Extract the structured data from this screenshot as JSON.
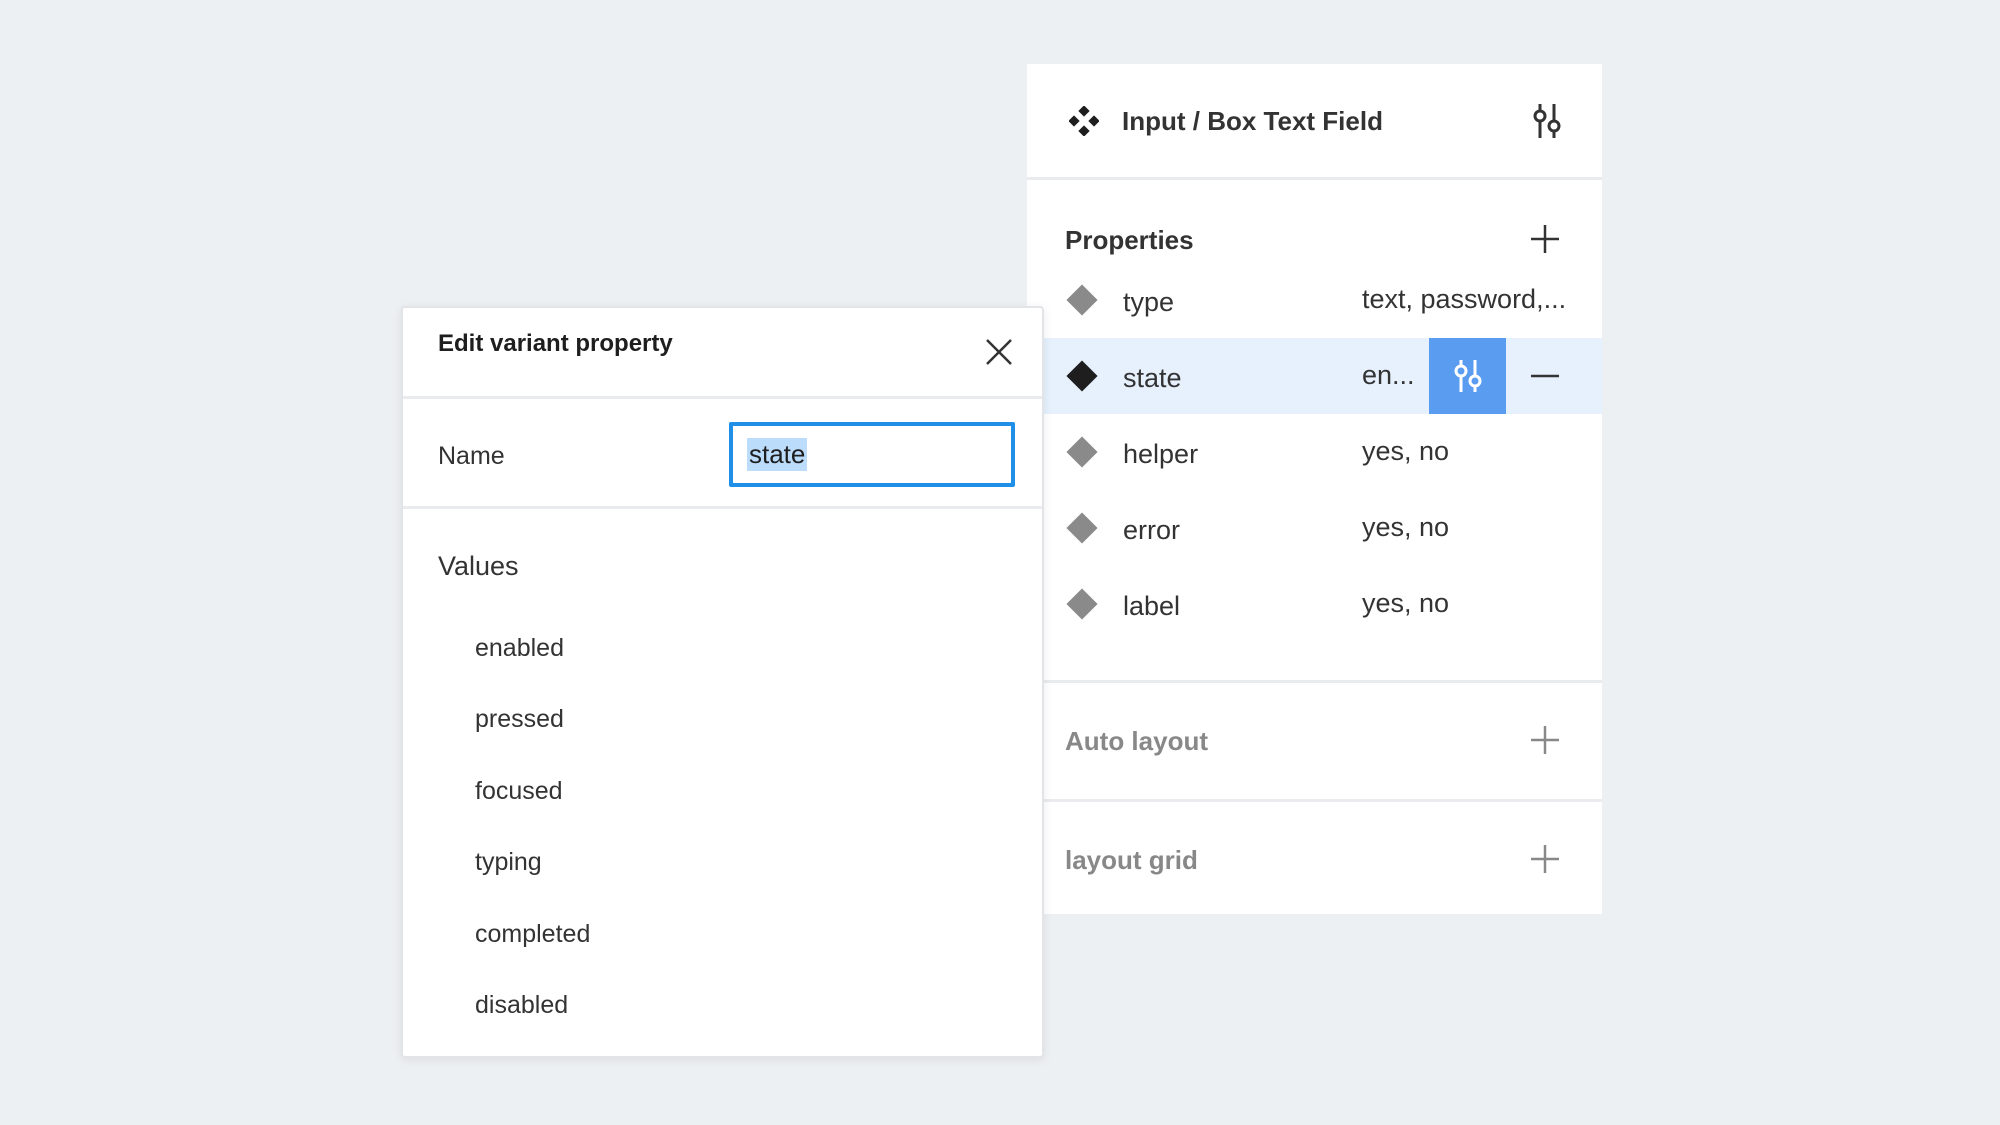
{
  "panel": {
    "component_title": "Input / Box Text Field",
    "properties": {
      "title": "Properties",
      "rows": [
        {
          "name": "type",
          "values": "text, password,..."
        },
        {
          "name": "state",
          "values": "en..."
        },
        {
          "name": "helper",
          "values": "yes, no"
        },
        {
          "name": "error",
          "values": "yes, no"
        },
        {
          "name": "label",
          "values": "yes, no"
        }
      ]
    },
    "auto_layout": {
      "title": "Auto layout"
    },
    "layout_grid": {
      "title": "layout grid"
    }
  },
  "dialog": {
    "title": "Edit variant property",
    "name_label": "Name",
    "name_value": "state",
    "values_title": "Values",
    "values": [
      "enabled",
      "pressed",
      "focused",
      "typing",
      "completed",
      "disabled"
    ]
  },
  "icons": {
    "component": "component-icon",
    "settings": "sliders-icon",
    "add": "plus-icon",
    "remove": "minus-icon",
    "close": "close-icon",
    "property": "diamond-icon"
  },
  "colors": {
    "background": "#edf0f3",
    "active_row": "#e6f1fd",
    "accent_button": "#5a9cf0",
    "input_focus": "#1f8fe8",
    "selection": "#bcdcfb"
  }
}
